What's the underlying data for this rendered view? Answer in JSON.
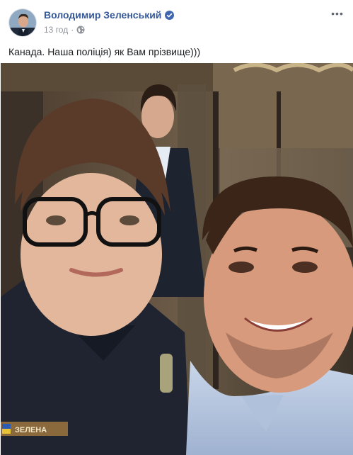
{
  "post": {
    "author_name": "Володимир Зеленський",
    "verified": true,
    "timestamp": "13 год",
    "audience_icon": "globe-icon",
    "more_icon": "more-options-icon",
    "text": "Канада. Наша поліція) як Вам прізвище)))"
  },
  "photo": {
    "description_icon": "selfie-photo",
    "name_tag": "ЗЕЛЕНА"
  },
  "colors": {
    "author_link": "#365899",
    "verified_badge": "#4267b2",
    "meta_text": "#90949c"
  }
}
